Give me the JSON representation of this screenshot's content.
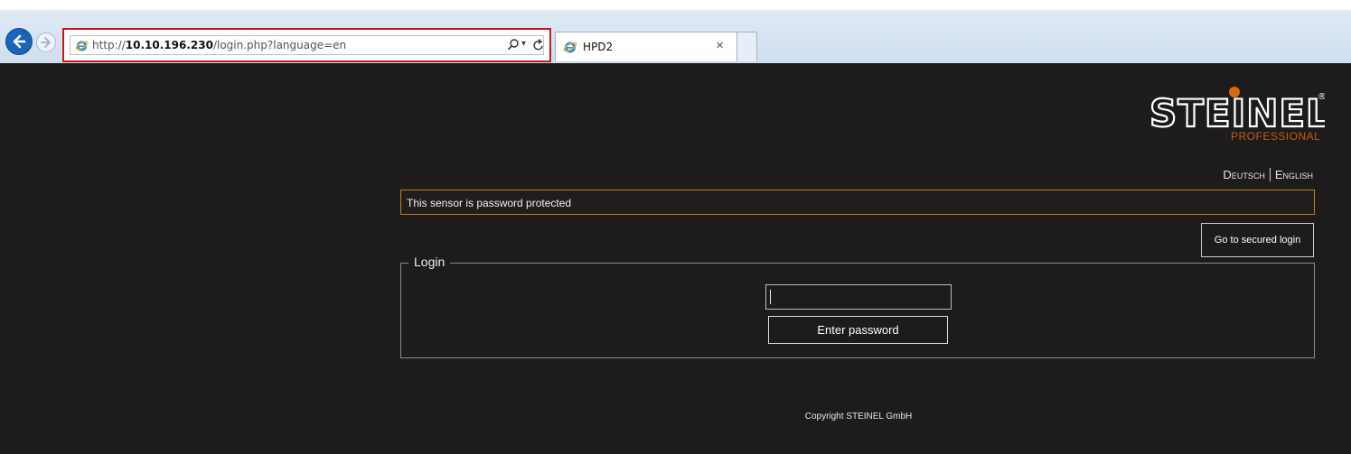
{
  "browser": {
    "address_url_prefix": "http://",
    "address_url_host": "10.10.196.230",
    "address_url_path": "/login.php?language=en",
    "tab_title": "HPD2",
    "tab_close": "×",
    "icons": [
      "back-arrow-icon",
      "forward-arrow-icon",
      "ie-icon",
      "search-icon",
      "dropdown-icon",
      "refresh-icon",
      "close-icon"
    ]
  },
  "header": {
    "logo_sub": "PROFESSIONAL",
    "languages": [
      "Deutsch",
      "English"
    ]
  },
  "notice": {
    "text": "This sensor is password protected"
  },
  "secured_login": {
    "label": "Go to secured login"
  },
  "login": {
    "legend": "Login",
    "password_value": "",
    "submit_label": "Enter password"
  },
  "footer": {
    "copyright": "Copyright STEINEL GmbH"
  },
  "colors": {
    "page_background": "#1d1b1c",
    "accent_orange": "#c75d12",
    "address_highlight": "#d01414"
  }
}
